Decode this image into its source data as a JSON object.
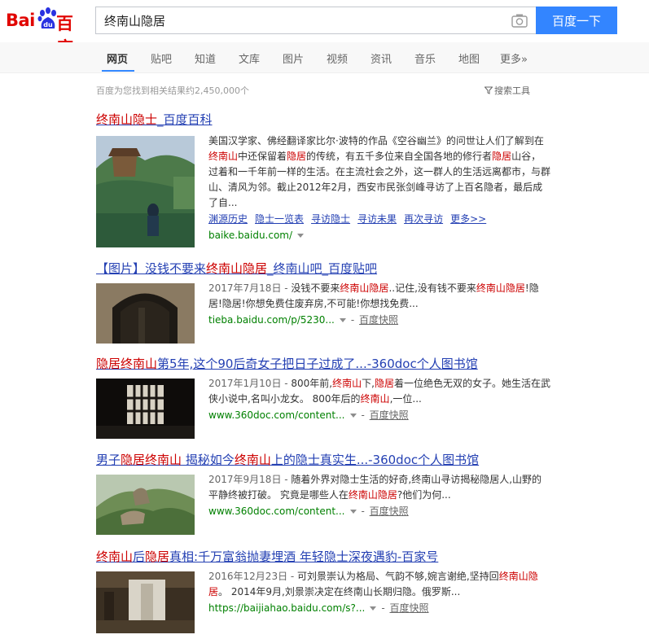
{
  "logo": {
    "left_text": "Bai",
    "paw_text": "du",
    "right_text": "百度",
    "color": "#e10602"
  },
  "search": {
    "value": "终南山隐居",
    "button_label": "百度一下",
    "camera_icon": "camera-icon"
  },
  "tabs": [
    {
      "label": "网页",
      "active": true
    },
    {
      "label": "贴吧"
    },
    {
      "label": "知道"
    },
    {
      "label": "文库"
    },
    {
      "label": "图片"
    },
    {
      "label": "视频"
    },
    {
      "label": "资讯"
    },
    {
      "label": "音乐"
    },
    {
      "label": "地图"
    },
    {
      "label": "更多»"
    }
  ],
  "result_count": "百度为您找到相关结果约2,450,000个",
  "tools_label": "搜索工具",
  "results": [
    {
      "title_parts": [
        {
          "t": "终南山隐士",
          "em": true
        },
        {
          "t": "_百度百科",
          "em": false
        }
      ],
      "text_parts": [
        {
          "t": "美国汉学家、佛经翻译家比尔·波特的作品《空谷幽兰》的问世让人们了解到在",
          "em": false
        },
        {
          "t": "终南山",
          "em": true
        },
        {
          "t": "中还保留着",
          "em": false
        },
        {
          "t": "隐居",
          "em": true
        },
        {
          "t": "的传统，有五千多位来自全国各地的修行者",
          "em": false
        },
        {
          "t": "隐居",
          "em": true
        },
        {
          "t": "山谷，过着和一千年前一样的生活。在主流社会之外，这一群人的生活远离都市，与群山、清风为邻。截止2012年2月，西安市民张剑峰寻访了上百名隐者，最后成了自...",
          "em": false
        }
      ],
      "sub_links": [
        "渊源历史",
        "隐士一览表",
        "寻访隐士",
        "寻访未果",
        "再次寻访",
        "更多>>"
      ],
      "url": "baike.baidu.com/"
    },
    {
      "title_parts": [
        {
          "t": "【图片】没钱不要来",
          "em": false
        },
        {
          "t": "终南山隐居",
          "em": true
        },
        {
          "t": "_终南山吧_百度贴吧",
          "em": false
        }
      ],
      "date": "2017年7月18日 - ",
      "text_parts": [
        {
          "t": "没钱不要来",
          "em": false
        },
        {
          "t": "终南山隐居",
          "em": true
        },
        {
          "t": "..记住,没有钱不要来",
          "em": false
        },
        {
          "t": "终南山隐居",
          "em": true
        },
        {
          "t": "!隐居!隐居!你想免费住废弃房,不可能!你想找免费...",
          "em": false
        }
      ],
      "url": "tieba.baidu.com/p/5230...",
      "snapshot": "百度快照"
    },
    {
      "title_parts": [
        {
          "t": "隐居终南山",
          "em": true
        },
        {
          "t": "第5年,这个90后奇女子把日子过成了...-360doc个人图书馆",
          "em": false
        }
      ],
      "date": "2017年1月10日 - ",
      "text_parts": [
        {
          "t": "800年前,",
          "em": false
        },
        {
          "t": "终南山",
          "em": true
        },
        {
          "t": "下,",
          "em": false
        },
        {
          "t": "隐居",
          "em": true
        },
        {
          "t": "着一位绝色无双的女子。她生活在武侠小说中,名叫小龙女。 800年后的",
          "em": false
        },
        {
          "t": "终南山",
          "em": true
        },
        {
          "t": ",一位...",
          "em": false
        }
      ],
      "url": "www.360doc.com/content...",
      "snapshot": "百度快照"
    },
    {
      "title_parts": [
        {
          "t": "男子",
          "em": false
        },
        {
          "t": "隐居终南山",
          "em": true
        },
        {
          "t": " 揭秘如今",
          "em": false
        },
        {
          "t": "终南山",
          "em": true
        },
        {
          "t": "上的隐士真实生...-360doc个人图书馆",
          "em": false
        }
      ],
      "date": "2017年9月18日 - ",
      "text_parts": [
        {
          "t": "随着外界对隐士生活的好奇,终南山寻访揭秘隐居人,山野的平静终被打破。 究竟是哪些人在",
          "em": false
        },
        {
          "t": "终南山隐居",
          "em": true
        },
        {
          "t": "?他们为何...",
          "em": false
        }
      ],
      "url": "www.360doc.com/content...",
      "snapshot": "百度快照"
    },
    {
      "title_parts": [
        {
          "t": "终南山",
          "em": true
        },
        {
          "t": "后",
          "em": false
        },
        {
          "t": "隐居",
          "em": true
        },
        {
          "t": "真相:千万富翁抛妻埋酒 年轻隐士深夜遇豹-百家号",
          "em": false
        }
      ],
      "date": "2016年12月23日 - ",
      "text_parts": [
        {
          "t": "可刘景崇认为格局、气韵不够,婉言谢绝,坚持回",
          "em": false
        },
        {
          "t": "终南山隐居",
          "em": true
        },
        {
          "t": "。 2014年9月,刘景崇决定在终南山长期归隐。俄罗斯...",
          "em": false
        }
      ],
      "url": "https://baijiahao.baidu.com/s?...",
      "snapshot": "百度快照"
    }
  ]
}
